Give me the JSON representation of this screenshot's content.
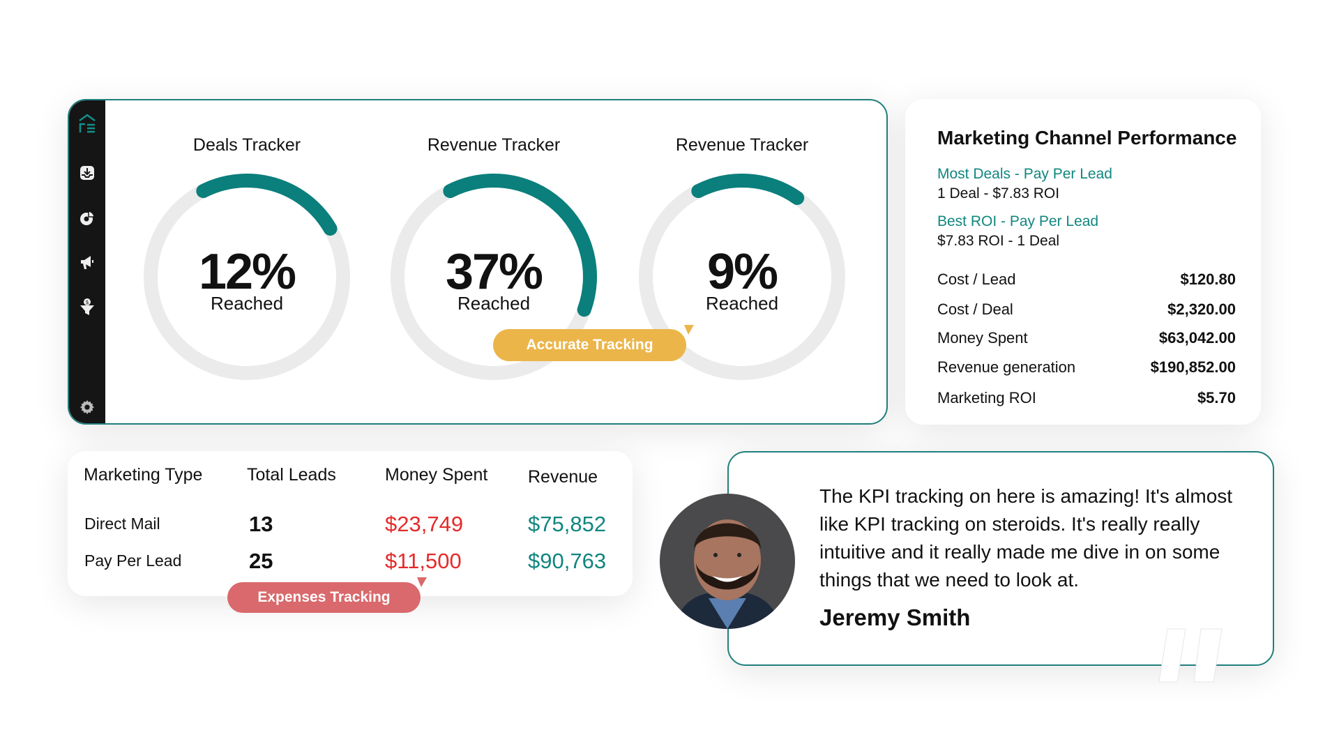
{
  "colors": {
    "teal": "#0a7f7c",
    "ring": "#ebebeb",
    "accurate": "#ebb54a",
    "expenses": "#d9696c",
    "spent": "#e52a2a",
    "revenue": "#11867f"
  },
  "sidebar": {
    "icons": [
      "home-logo-icon",
      "inbox-download-icon",
      "analytics-chart-icon",
      "megaphone-icon",
      "funnel-dollar-icon",
      "gear-icon"
    ]
  },
  "gauges": [
    {
      "title": "Deals Tracker",
      "percent": "12%",
      "label": "Reached",
      "value": 12
    },
    {
      "title": "Revenue Tracker",
      "percent": "37%",
      "label": "Reached",
      "value": 37
    },
    {
      "title": "Revenue Tracker",
      "percent": "9%",
      "label": "Reached",
      "value": 9
    }
  ],
  "badges": {
    "accurate": "Accurate Tracking",
    "expenses": "Expenses Tracking"
  },
  "performance": {
    "title": "Marketing Channel Performance",
    "most_deals": "Most Deals - Pay Per Lead",
    "most_deals_detail": "1 Deal - $7.83 ROI",
    "best_roi": "Best ROI - Pay Per Lead",
    "best_roi_detail": "$7.83 ROI -  1 Deal",
    "rows": [
      {
        "label": "Cost / Lead",
        "value": "$120.80"
      },
      {
        "label": "Cost / Deal",
        "value": "$2,320.00"
      },
      {
        "label": "Money Spent",
        "value": "$63,042.00"
      },
      {
        "label": "Revenue generation",
        "value": "$190,852.00"
      },
      {
        "label": "Marketing ROI",
        "value": "$5.70"
      }
    ]
  },
  "table": {
    "headers": [
      "Marketing Type",
      "Total Leads",
      "Money Spent",
      "Revenue"
    ],
    "rows": [
      {
        "type": "Direct Mail",
        "leads": "13",
        "spent": "$23,749",
        "revenue": "$75,852"
      },
      {
        "type": "Pay Per Lead",
        "leads": "25",
        "spent": "$11,500",
        "revenue": "$90,763"
      }
    ]
  },
  "testimonial": {
    "lines": [
      "The KPI tracking on here is amazing! It's almost",
      "like KPI tracking on steroids. It's really really",
      "intuitive and it really made me dive in on some",
      "things that we need to look at."
    ],
    "author": "Jeremy Smith"
  }
}
